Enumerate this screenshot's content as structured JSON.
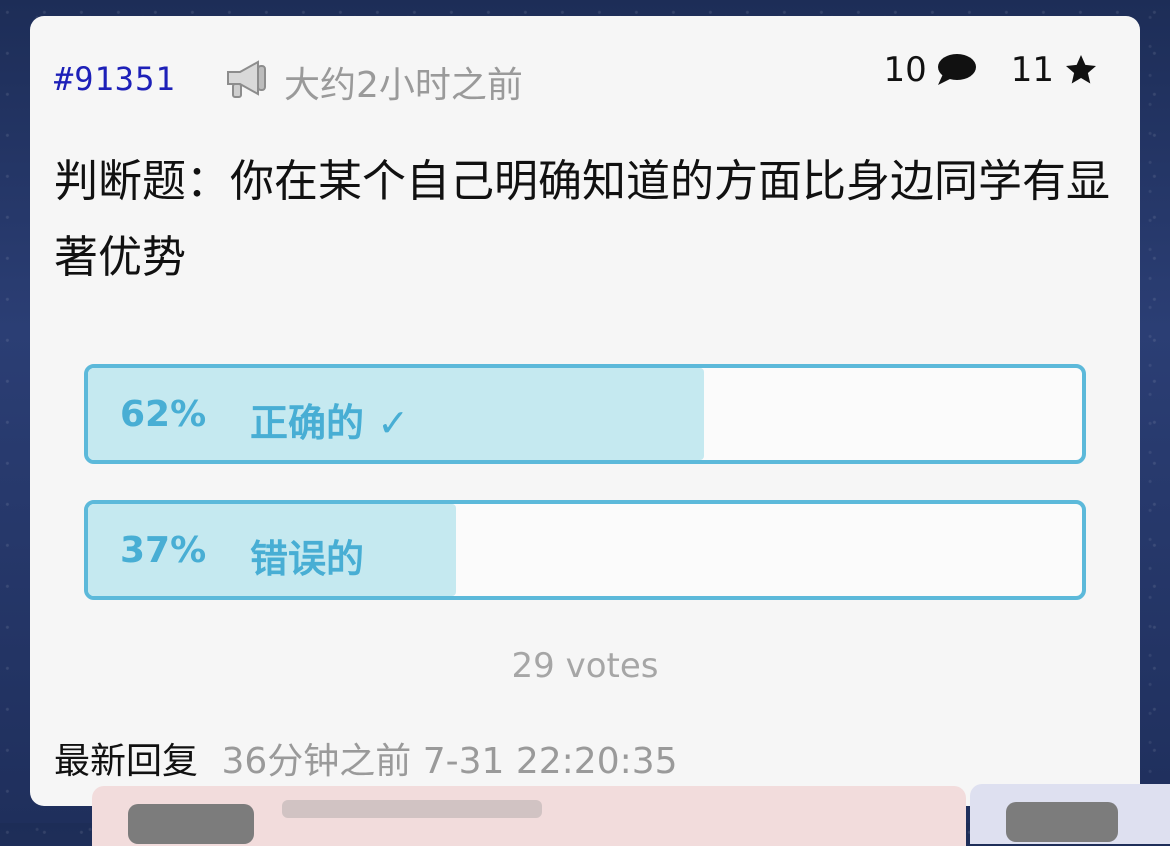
{
  "post": {
    "id": "#91351",
    "time_ago": "大约2小时之前",
    "comments_count": "10",
    "stars_count": "11",
    "title": "判断题：你在某个自己明确知道的方面比身边同学有显著优势"
  },
  "poll": {
    "options": [
      {
        "percent": "62%",
        "label": "正确的 ✓",
        "fraction": 0.62
      },
      {
        "percent": "37%",
        "label": "错误的",
        "fraction": 0.37
      }
    ],
    "votes": "29 votes"
  },
  "latest_reply": {
    "label": "最新回复",
    "value": "36分钟之前 7-31 22:20:35"
  },
  "icons": {
    "megaphone": "megaphone-icon",
    "comment": "comment-icon",
    "star": "star-icon"
  },
  "colors": {
    "id_link": "#1d20b8",
    "poll_accent": "#5cb9da",
    "poll_fill": "#c5e9f0"
  }
}
